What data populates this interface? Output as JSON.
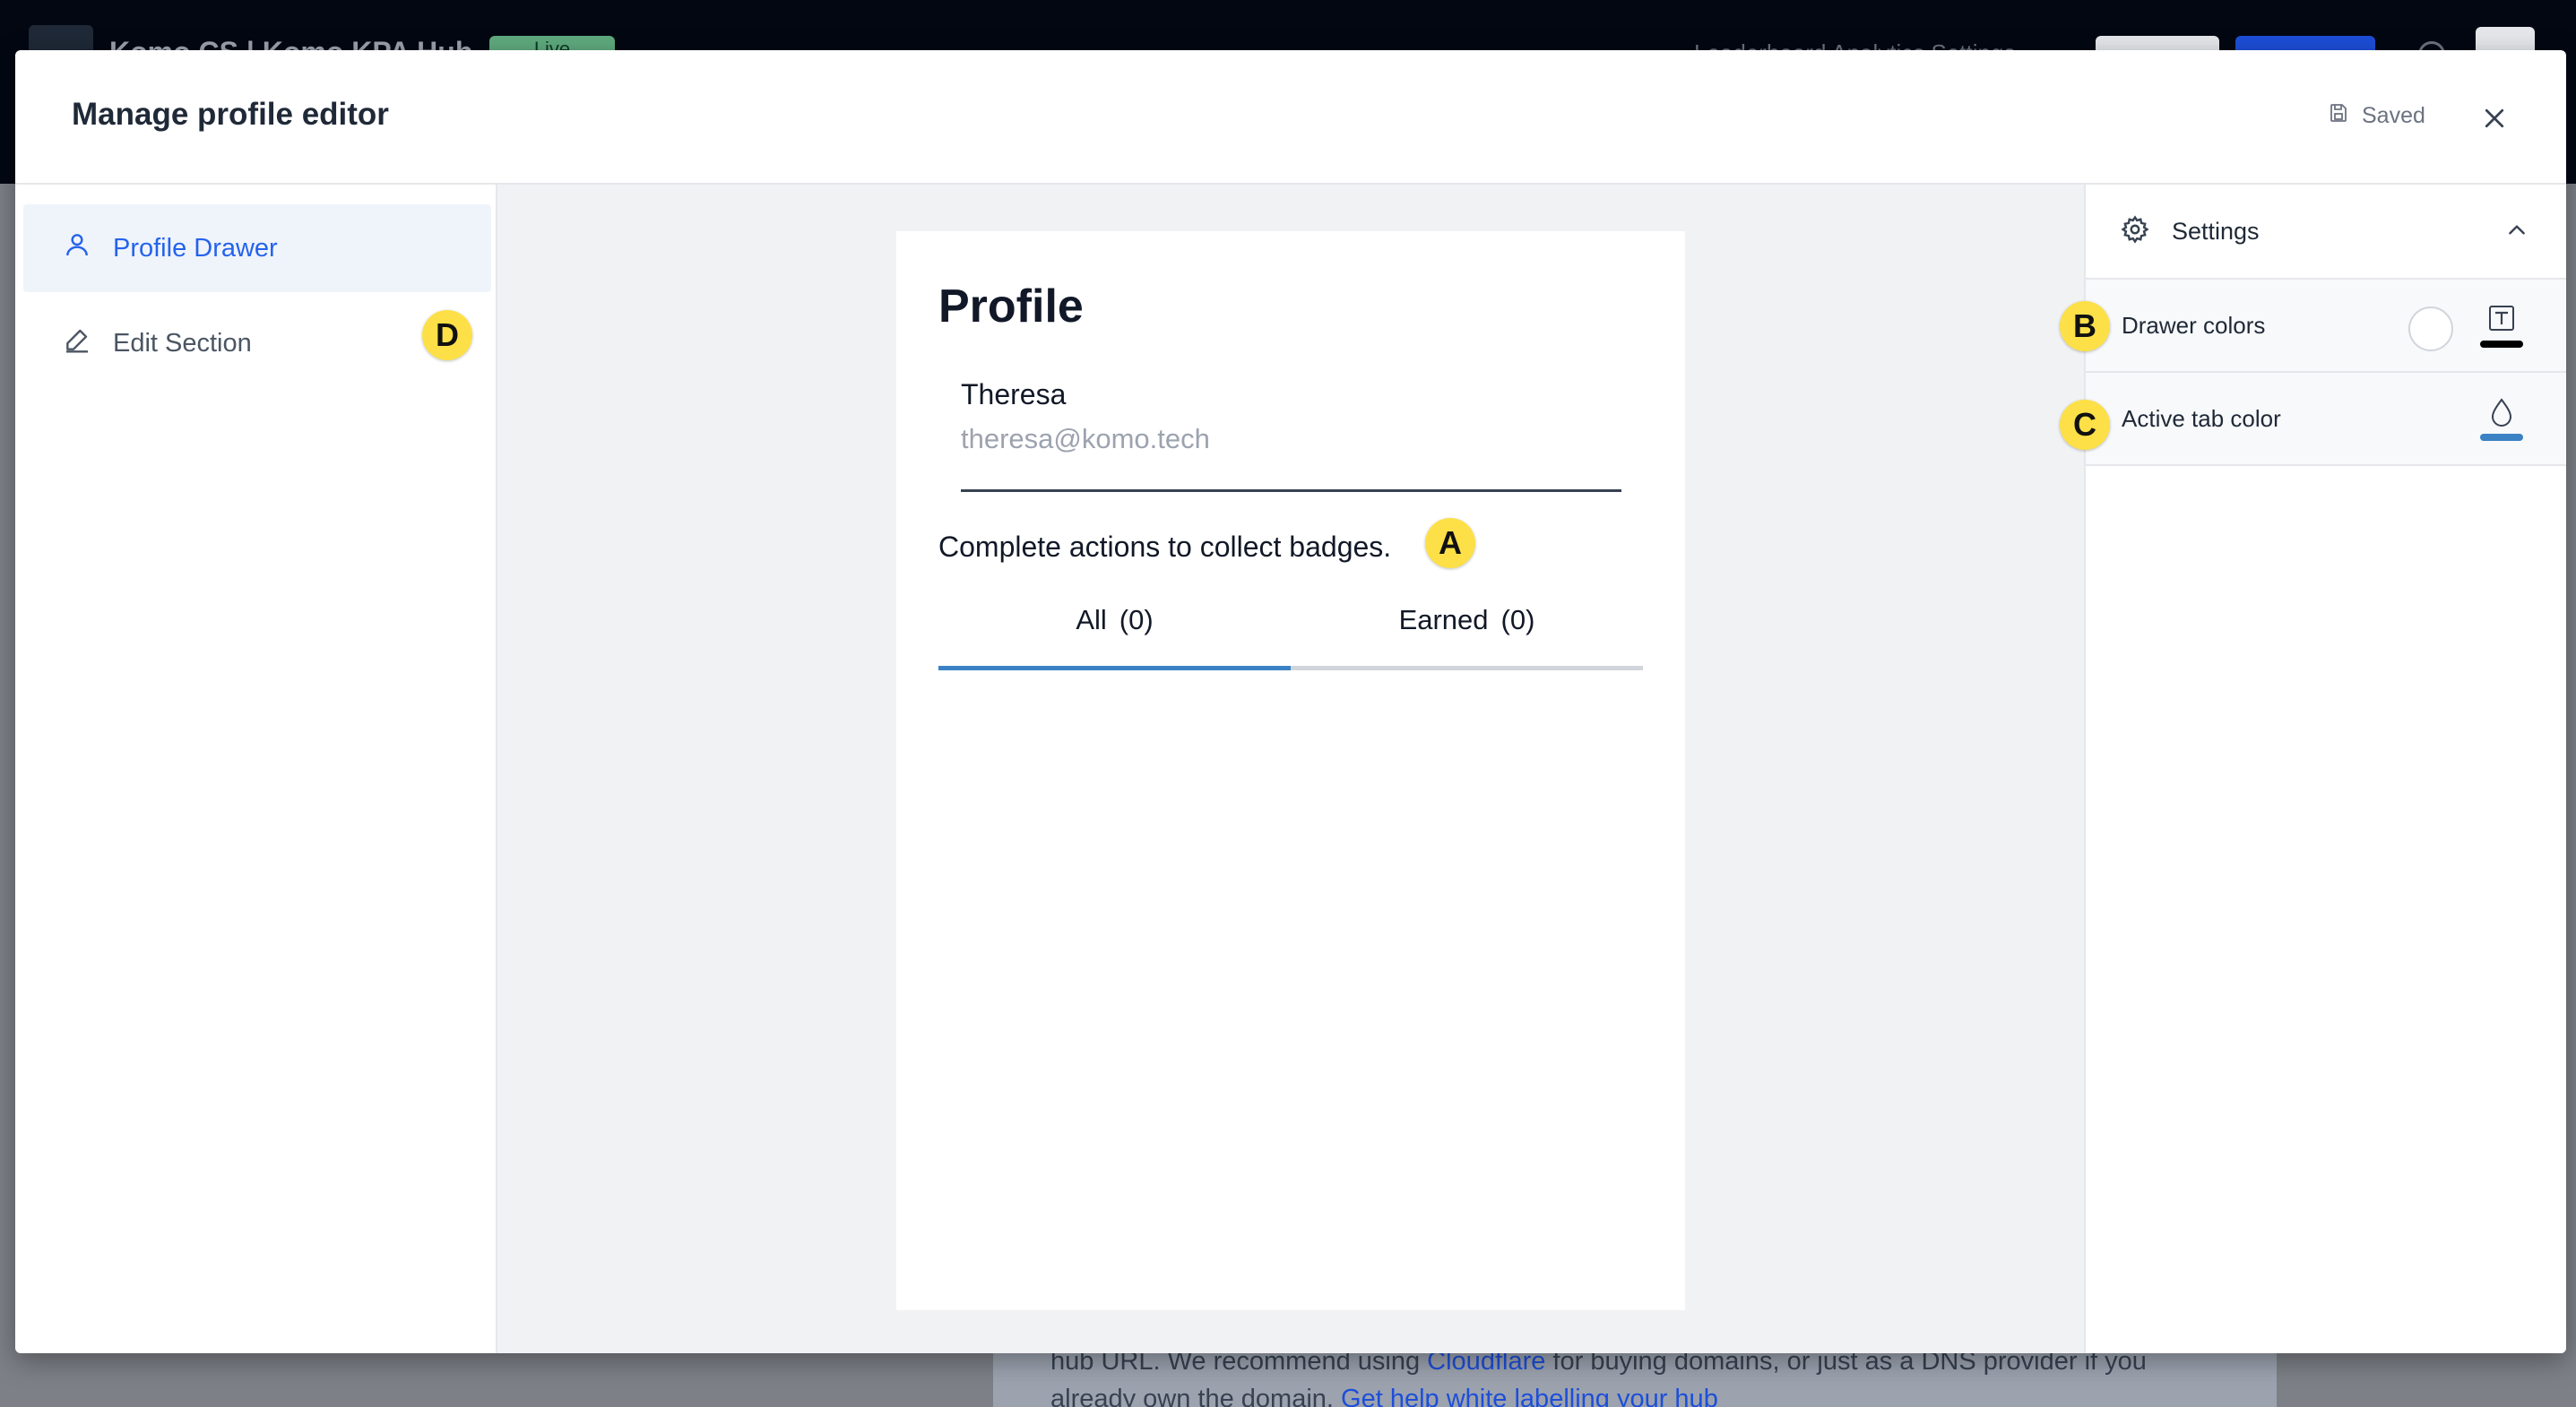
{
  "background": {
    "app_title": "Komo CS | Komo KPA Hub",
    "status_badge": "Live",
    "nav_text": "Leaderboard  Analytics  Settings",
    "footer_line1_a": "hub URL. We recommend using",
    "footer_link_cloudflare": "Cloudflare",
    "footer_line1_b": "for buying domains, or just as a DNS provider if you",
    "footer_line2": "already own the domain.",
    "footer_link_help": "Get help white labelling your hub"
  },
  "modal": {
    "title": "Manage profile editor",
    "saved_label": "Saved",
    "icons": {
      "saved": "save-icon",
      "close": "close-icon"
    }
  },
  "left_nav": {
    "items": [
      {
        "label": "Profile Drawer",
        "icon": "user-icon",
        "active": true
      },
      {
        "label": "Edit Section",
        "icon": "pencil-icon",
        "active": false
      }
    ]
  },
  "profile_card": {
    "heading": "Profile",
    "name": "Theresa",
    "email": "theresa@komo.tech",
    "badges_text": "Complete actions to collect badges.",
    "tabs": [
      {
        "label": "All",
        "count": "(0)",
        "active": true
      },
      {
        "label": "Earned",
        "count": "(0)",
        "active": false
      }
    ]
  },
  "settings": {
    "title": "Settings",
    "rows": [
      {
        "label": "Drawer colors",
        "background_color": "#ffffff",
        "text_color": "#000000"
      },
      {
        "label": "Active tab color",
        "color": "#3b82c4"
      }
    ]
  },
  "markers": {
    "a": "A",
    "b": "B",
    "c": "C",
    "d": "D"
  },
  "colors": {
    "accent": "#2563eb",
    "tab_indicator": "#3b82c4",
    "marker": "#fde047"
  }
}
